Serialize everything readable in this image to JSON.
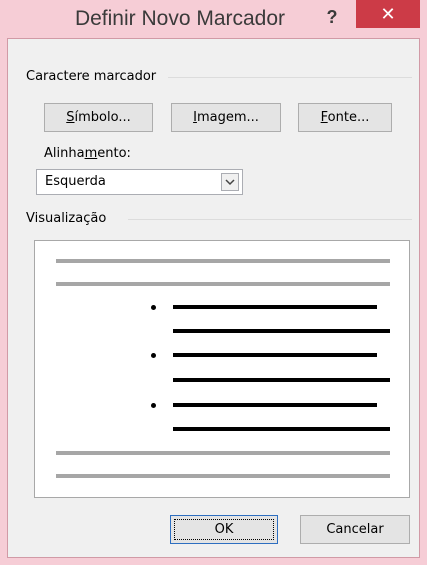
{
  "dialog": {
    "title": "Definir Novo Marcador",
    "help_glyph": "?",
    "close_glyph": "✕"
  },
  "bullet_group": {
    "title": "Caractere marcador",
    "symbol_prefix": "S",
    "symbol_rest": "ímbolo...",
    "image_prefix": "I",
    "image_rest": "magem...",
    "font_prefix": "F",
    "font_rest": "onte..."
  },
  "alignment": {
    "label_a": "Alinha",
    "label_u": "m",
    "label_b": "ento:",
    "value": "Esquerda"
  },
  "preview": {
    "title": "Visualização"
  },
  "footer": {
    "ok_label": "OK",
    "cancel_label": "Cancelar"
  },
  "colors": {
    "titlebar": "#f6cdd6",
    "close_button": "#cc3b47"
  }
}
